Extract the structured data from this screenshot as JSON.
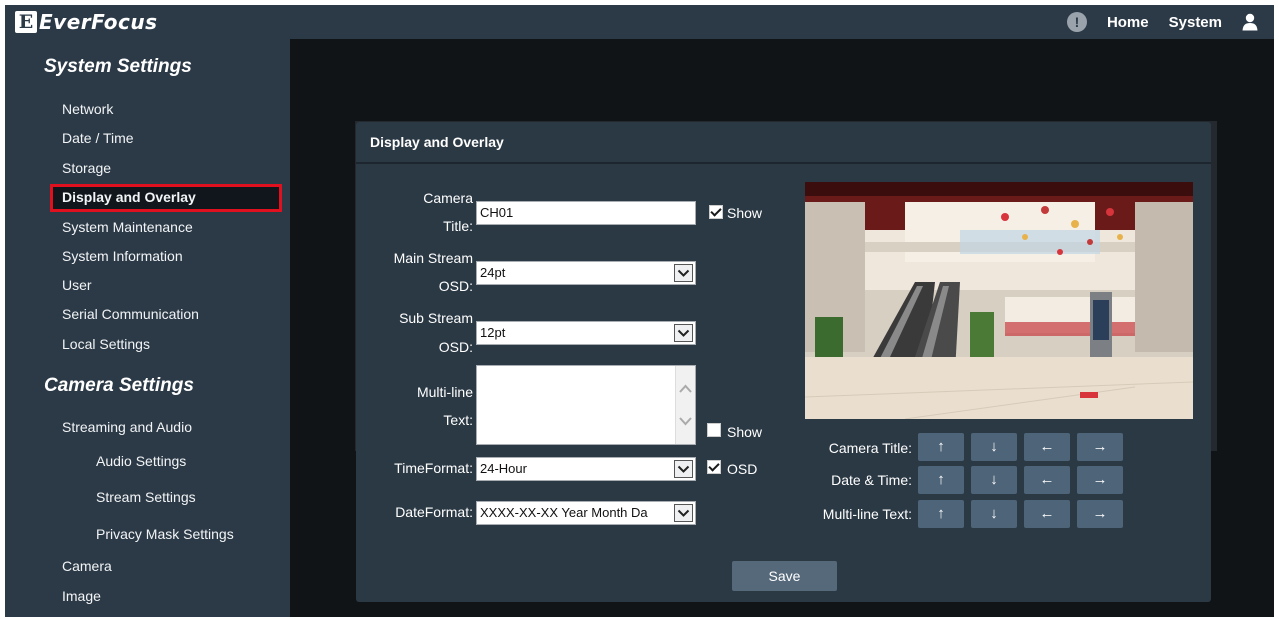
{
  "header": {
    "brand": "EverFocus",
    "brand_mark": "E",
    "alert_glyph": "!",
    "nav_home": "Home",
    "nav_system": "System"
  },
  "sidebar": {
    "system_settings_title": "System Settings",
    "system_items": [
      "Network",
      "Date / Time",
      "Storage",
      "Display and Overlay",
      "System Maintenance",
      "System Information",
      "User",
      "Serial Communication",
      "Local Settings"
    ],
    "camera_settings_title": "Camera Settings",
    "camera_items": [
      "Streaming and Audio",
      "Audio Settings",
      "Stream Settings",
      "Privacy Mask Settings",
      "Camera",
      "Image"
    ],
    "active_item": "Display and Overlay"
  },
  "panel": {
    "title": "Display and Overlay",
    "camera_title_label_1": "Camera",
    "camera_title_label_2": "Title:",
    "camera_title_value": "CH01",
    "show_label": "Show",
    "camera_title_show_checked": true,
    "main_stream_label_1": "Main Stream",
    "main_stream_label_2": "OSD:",
    "main_stream_value": "24pt",
    "sub_stream_label_1": "Sub Stream",
    "sub_stream_label_2": "OSD:",
    "sub_stream_value": "12pt",
    "multiline_label_1": "Multi-line",
    "multiline_label_2": "Text:",
    "multiline_show_checked": false,
    "time_format_label": "TimeFormat:",
    "time_format_value": "24-Hour",
    "osd_label": "OSD",
    "osd_checked": true,
    "date_format_label": "DateFormat:",
    "date_format_value": "XXXX-XX-XX Year Month Da",
    "pos_camera_title_label": "Camera Title:",
    "pos_date_time_label": "Date & Time:",
    "pos_multiline_label": "Multi-line Text:",
    "arrow_up": "↑",
    "arrow_down": "↓",
    "arrow_left": "←",
    "arrow_right": "→",
    "save_label": "Save"
  },
  "colors": {
    "sidebar_bg": "#2c3a47",
    "page_bg": "#101417",
    "panel_bg": "#2b3945",
    "highlight_border": "#e0101e",
    "button_bg": "#4e6478"
  }
}
